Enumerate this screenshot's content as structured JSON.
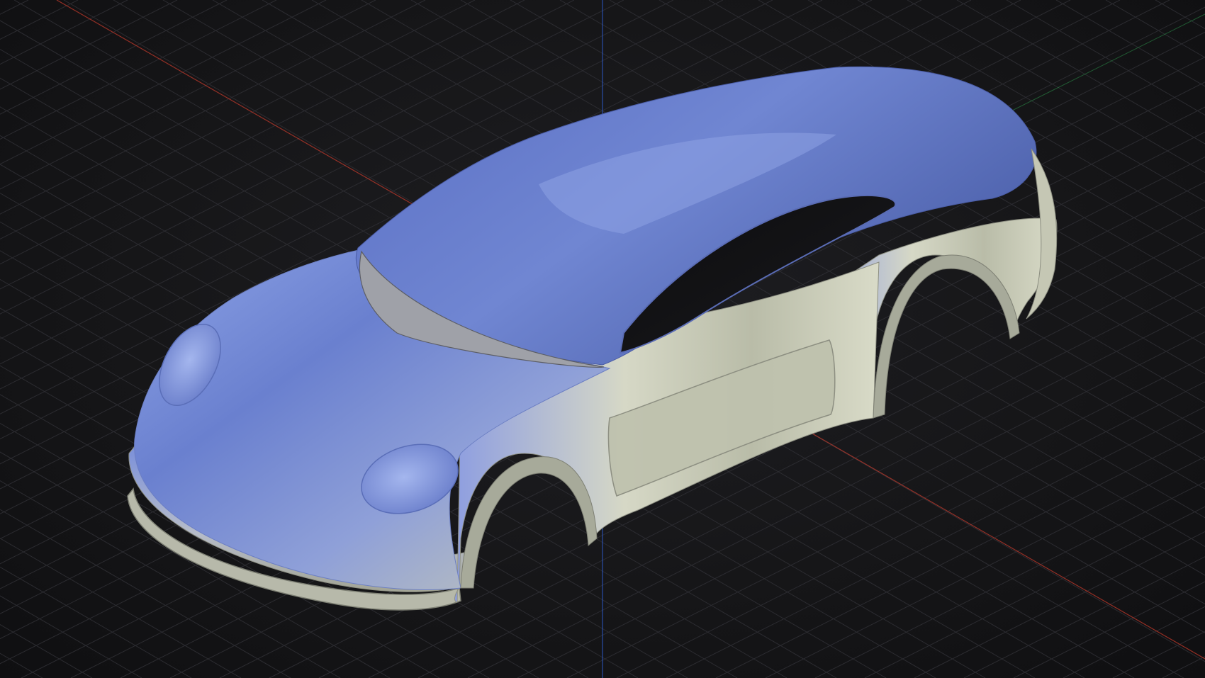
{
  "viewport": {
    "view_mode": "perspective",
    "grid_visible": true,
    "axes_visible": true
  },
  "axes": {
    "x_axis_color": "#c0392b",
    "y_axis_color": "#2e9e4f",
    "z_axis_color": "#2f5fd6"
  },
  "model": {
    "type": "car body shell",
    "shading": "glossy metallic",
    "colors": {
      "highlight_blue": "#8fa6e8",
      "body_blue": "#5f76c8",
      "shadow_blue": "#3d4f9a",
      "silver": "#c9ccb8",
      "edge": "#9a9c8e"
    }
  },
  "grid": {
    "line_color": "#2c2c31",
    "background": "#161618"
  }
}
